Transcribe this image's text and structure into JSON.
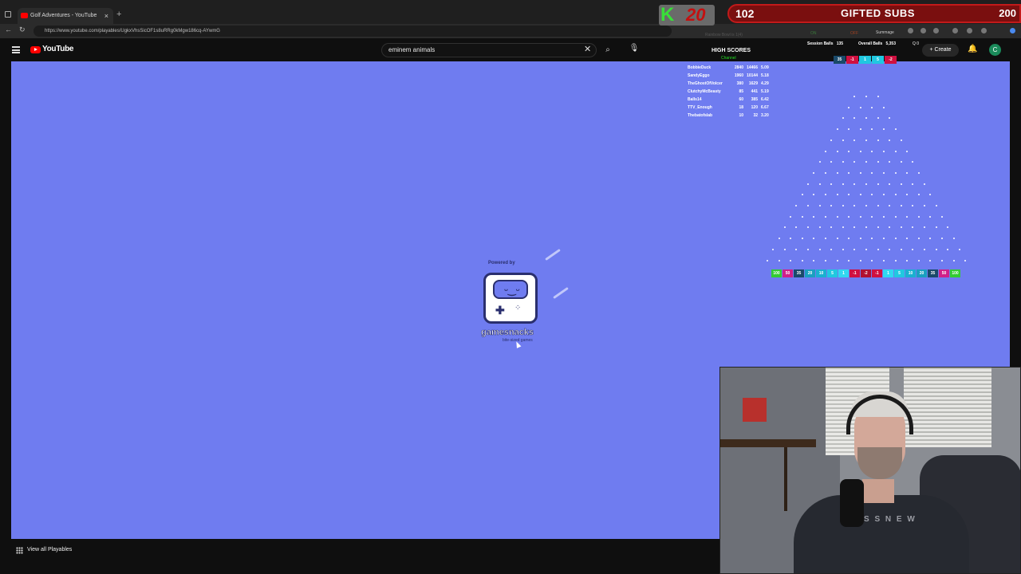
{
  "browser": {
    "tab_title": "Golf Adventures - YouTube",
    "url": "https://www.youtube.com/playables/UgkxVhsSicOF1s8uRRg0kMgw186cq-AYwmG"
  },
  "overlay": {
    "k_letter": "K",
    "k_count": "20",
    "subs_count": "102",
    "subs_label": "GIFTED SUBS",
    "subs_goal": "200"
  },
  "youtube": {
    "logo_text": "YouTube",
    "search_value": "eminem animals",
    "create_label": "Create",
    "avatar_letter": "C",
    "view_all_label": "View all Playables"
  },
  "game": {
    "powered_by": "Powered by",
    "brand": "gamesnacks",
    "tagline": "bite-sized games"
  },
  "high_scores": {
    "title": "HIGH SCORES",
    "subtitle": "Channel",
    "rows": [
      {
        "name": "BobbieDuck",
        "a": "2840",
        "b": "14466",
        "r": "5.09"
      },
      {
        "name": "SandyEggo",
        "a": "1960",
        "b": "10144",
        "r": "5.18"
      },
      {
        "name": "TheGhostOfVolcer",
        "a": "380",
        "b": "1629",
        "r": "4.29"
      },
      {
        "name": "ClutchyMcBeasty",
        "a": "85",
        "b": "441",
        "r": "5.19"
      },
      {
        "name": "Balls14",
        "a": "60",
        "b": "385",
        "r": "6.42"
      },
      {
        "name": "TTV_Enough",
        "a": "18",
        "b": "120",
        "r": "6.67"
      },
      {
        "name": "Thebatofslab",
        "a": "10",
        "b": "32",
        "r": "3.20"
      }
    ]
  },
  "plinko": {
    "session_label": "Session Balls",
    "session_value": "135",
    "overall_label": "Overall Balls",
    "overall_value": "5,353",
    "q_label": "Q",
    "q_value": "0",
    "faint_1": "Rainbow Bowl is 1(4)",
    "faint_2": "ON",
    "faint_3": "OFF",
    "faint_4": "Summage",
    "recent": [
      {
        "v": "35",
        "c": "#1a4a6a"
      },
      {
        "v": "-1",
        "c": "#d01040"
      },
      {
        "v": "1",
        "c": "#20c8e0"
      },
      {
        "v": "5",
        "c": "#20c8e0"
      },
      {
        "v": "-2",
        "c": "#d01040"
      }
    ],
    "slots": [
      {
        "v": "100",
        "c": "#33cc33"
      },
      {
        "v": "50",
        "c": "#d0208a"
      },
      {
        "v": "35",
        "c": "#1a4a6a"
      },
      {
        "v": "20",
        "c": "#1aa0c0"
      },
      {
        "v": "10",
        "c": "#1ab0d0"
      },
      {
        "v": "5",
        "c": "#20c8e0"
      },
      {
        "v": "1",
        "c": "#30d8f0"
      },
      {
        "v": "-1",
        "c": "#d01040"
      },
      {
        "v": "-2",
        "c": "#b01030"
      },
      {
        "v": "-1",
        "c": "#d01040"
      },
      {
        "v": "1",
        "c": "#30d8f0"
      },
      {
        "v": "5",
        "c": "#20c8e0"
      },
      {
        "v": "10",
        "c": "#1ab0d0"
      },
      {
        "v": "20",
        "c": "#1aa0c0"
      },
      {
        "v": "35",
        "c": "#1a4a6a"
      },
      {
        "v": "50",
        "c": "#d0208a"
      },
      {
        "v": "100",
        "c": "#33cc33"
      }
    ]
  },
  "webcam": {
    "shirt_text": "S S N E W"
  }
}
